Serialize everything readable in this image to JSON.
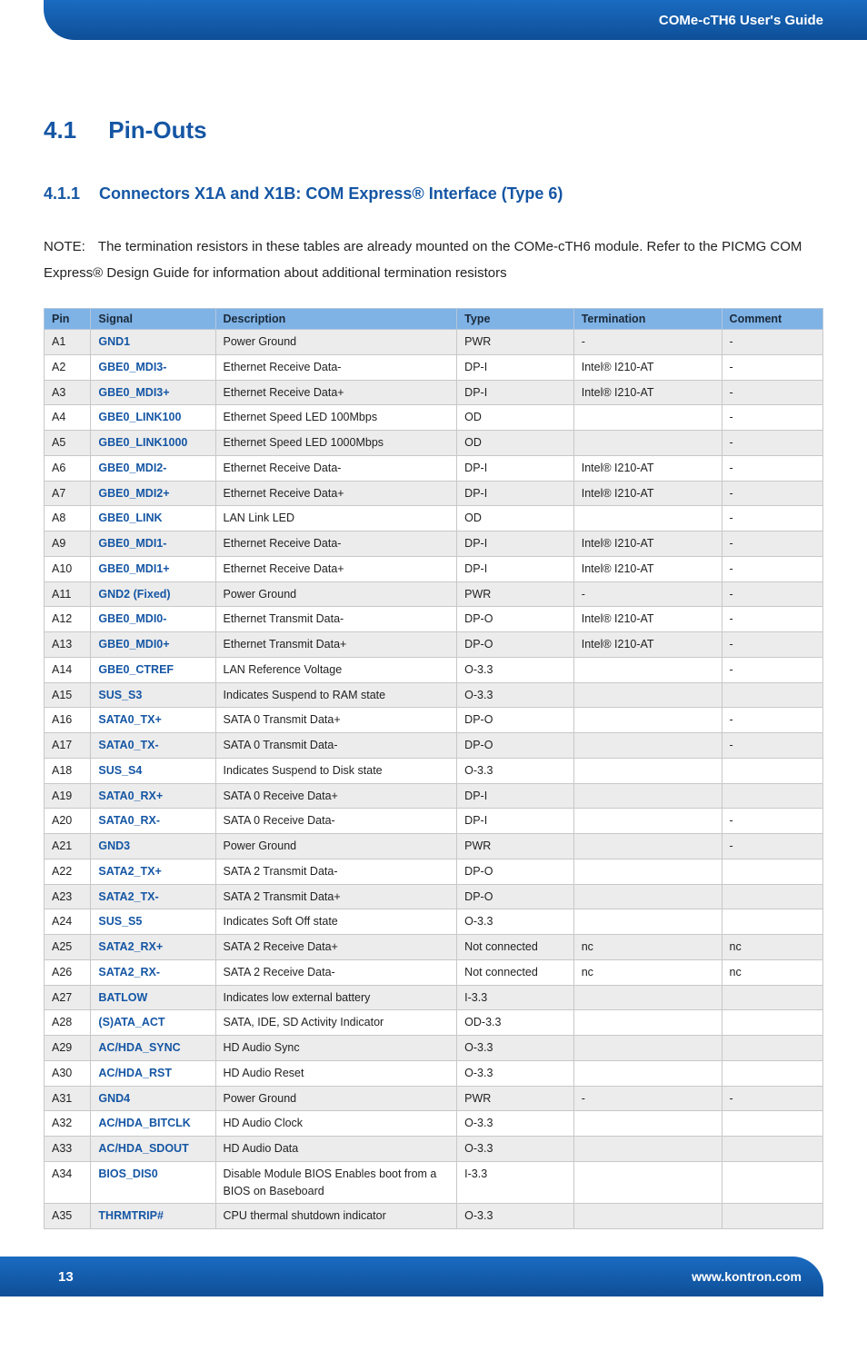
{
  "header": {
    "title": "COMe-cTH6 User's Guide"
  },
  "footer": {
    "page": "13",
    "url": "www.kontron.com"
  },
  "section": {
    "number": "4.1",
    "title": "Pin-Outs"
  },
  "subsection": {
    "number": "4.1.1",
    "title": "Connectors X1A and X1B: COM Express® Interface (Type 6)"
  },
  "note": {
    "label": "NOTE:",
    "text": "The termination resistors in these tables are already mounted on the COMe-cTH6 module. Refer to the PICMG COM Express® Design Guide for information about additional termination resistors"
  },
  "table": {
    "headers": {
      "pin": "Pin",
      "signal": "Signal",
      "description": "Description",
      "type": "Type",
      "termination": "Termination",
      "comment": "Comment"
    },
    "rows": [
      {
        "pin": "A1",
        "signal": "GND1",
        "desc": "Power Ground",
        "type": "PWR",
        "term": "-",
        "comm": "-"
      },
      {
        "pin": "A2",
        "signal": "GBE0_MDI3-",
        "desc": "Ethernet Receive Data-",
        "type": "DP-I",
        "term": "Intel® I210-AT",
        "comm": "-"
      },
      {
        "pin": "A3",
        "signal": "GBE0_MDI3+",
        "desc": "Ethernet Receive Data+",
        "type": "DP-I",
        "term": "Intel® I210-AT",
        "comm": "-"
      },
      {
        "pin": "A4",
        "signal": "GBE0_LINK100",
        "desc": "Ethernet Speed LED 100Mbps",
        "type": "OD",
        "term": "",
        "comm": "-"
      },
      {
        "pin": "A5",
        "signal": "GBE0_LINK1000",
        "desc": "Ethernet Speed LED 1000Mbps",
        "type": "OD",
        "term": "",
        "comm": "-"
      },
      {
        "pin": "A6",
        "signal": "GBE0_MDI2-",
        "desc": "Ethernet Receive Data-",
        "type": "DP-I",
        "term": "Intel® I210-AT",
        "comm": "-"
      },
      {
        "pin": "A7",
        "signal": "GBE0_MDI2+",
        "desc": "Ethernet Receive Data+",
        "type": "DP-I",
        "term": "Intel® I210-AT",
        "comm": "-"
      },
      {
        "pin": "A8",
        "signal": "GBE0_LINK",
        "desc": "LAN Link LED",
        "type": "OD",
        "term": "",
        "comm": "-"
      },
      {
        "pin": "A9",
        "signal": "GBE0_MDI1-",
        "desc": "Ethernet Receive Data-",
        "type": "DP-I",
        "term": "Intel® I210-AT",
        "comm": "-"
      },
      {
        "pin": "A10",
        "signal": "GBE0_MDI1+",
        "desc": "Ethernet Receive Data+",
        "type": "DP-I",
        "term": "Intel® I210-AT",
        "comm": "-"
      },
      {
        "pin": "A11",
        "signal": "GND2 (Fixed)",
        "desc": "Power Ground",
        "type": "PWR",
        "term": "-",
        "comm": "-"
      },
      {
        "pin": "A12",
        "signal": "GBE0_MDI0-",
        "desc": "Ethernet Transmit Data-",
        "type": "DP-O",
        "term": "Intel® I210-AT",
        "comm": "-"
      },
      {
        "pin": "A13",
        "signal": "GBE0_MDI0+",
        "desc": "Ethernet Transmit Data+",
        "type": "DP-O",
        "term": "Intel® I210-AT",
        "comm": "-"
      },
      {
        "pin": "A14",
        "signal": "GBE0_CTREF",
        "desc": "LAN Reference Voltage",
        "type": "O-3.3",
        "term": "",
        "comm": "-"
      },
      {
        "pin": "A15",
        "signal": "SUS_S3",
        "desc": "Indicates Suspend to RAM state",
        "type": "O-3.3",
        "term": "",
        "comm": ""
      },
      {
        "pin": "A16",
        "signal": "SATA0_TX+",
        "desc": "SATA 0 Transmit Data+",
        "type": "DP-O",
        "term": "",
        "comm": "-"
      },
      {
        "pin": "A17",
        "signal": "SATA0_TX-",
        "desc": "SATA 0 Transmit Data-",
        "type": "DP-O",
        "term": "",
        "comm": "-"
      },
      {
        "pin": "A18",
        "signal": "SUS_S4",
        "desc": "Indicates Suspend to Disk state",
        "type": "O-3.3",
        "term": "",
        "comm": ""
      },
      {
        "pin": "A19",
        "signal": "SATA0_RX+",
        "desc": "SATA 0 Receive Data+",
        "type": "DP-I",
        "term": "",
        "comm": ""
      },
      {
        "pin": "A20",
        "signal": "SATA0_RX-",
        "desc": "SATA 0 Receive Data-",
        "type": "DP-I",
        "term": "",
        "comm": "-"
      },
      {
        "pin": "A21",
        "signal": "GND3",
        "desc": "Power Ground",
        "type": "PWR",
        "term": "",
        "comm": "-"
      },
      {
        "pin": "A22",
        "signal": "SATA2_TX+",
        "desc": "SATA 2 Transmit Data-",
        "type": "DP-O",
        "term": "",
        "comm": ""
      },
      {
        "pin": "A23",
        "signal": "SATA2_TX-",
        "desc": "SATA 2 Transmit Data+",
        "type": "DP-O",
        "term": "",
        "comm": ""
      },
      {
        "pin": "A24",
        "signal": "SUS_S5",
        "desc": "Indicates Soft Off state",
        "type": "O-3.3",
        "term": "",
        "comm": ""
      },
      {
        "pin": "A25",
        "signal": "SATA2_RX+",
        "desc": "SATA 2 Receive Data+",
        "type": "Not connected",
        "term": "nc",
        "comm": "nc"
      },
      {
        "pin": "A26",
        "signal": "SATA2_RX-",
        "desc": "SATA 2 Receive Data-",
        "type": "Not connected",
        "term": "nc",
        "comm": "nc"
      },
      {
        "pin": "A27",
        "signal": "BATLOW",
        "desc": "Indicates low external battery",
        "type": "I-3.3",
        "term": "",
        "comm": ""
      },
      {
        "pin": "A28",
        "signal": "(S)ATA_ACT",
        "desc": "SATA, IDE, SD Activity Indicator",
        "type": "OD-3.3",
        "term": "",
        "comm": ""
      },
      {
        "pin": "A29",
        "signal": "AC/HDA_SYNC",
        "desc": "HD Audio Sync",
        "type": "O-3.3",
        "term": "",
        "comm": ""
      },
      {
        "pin": "A30",
        "signal": "AC/HDA_RST",
        "desc": "HD Audio Reset",
        "type": "O-3.3",
        "term": "",
        "comm": ""
      },
      {
        "pin": "A31",
        "signal": "GND4",
        "desc": "Power Ground",
        "type": "PWR",
        "term": "-",
        "comm": "-"
      },
      {
        "pin": "A32",
        "signal": "AC/HDA_BITCLK",
        "desc": "HD Audio Clock",
        "type": "O-3.3",
        "term": "",
        "comm": ""
      },
      {
        "pin": "A33",
        "signal": "AC/HDA_SDOUT",
        "desc": "HD Audio Data",
        "type": "O-3.3",
        "term": "",
        "comm": ""
      },
      {
        "pin": "A34",
        "signal": "BIOS_DIS0",
        "desc": "Disable Module BIOS Enables boot from a BIOS on Baseboard",
        "type": "I-3.3",
        "term": "",
        "comm": ""
      },
      {
        "pin": "A35",
        "signal": "THRMTRIP#",
        "desc": "CPU thermal shutdown indicator",
        "type": "O-3.3",
        "term": "",
        "comm": ""
      }
    ]
  }
}
